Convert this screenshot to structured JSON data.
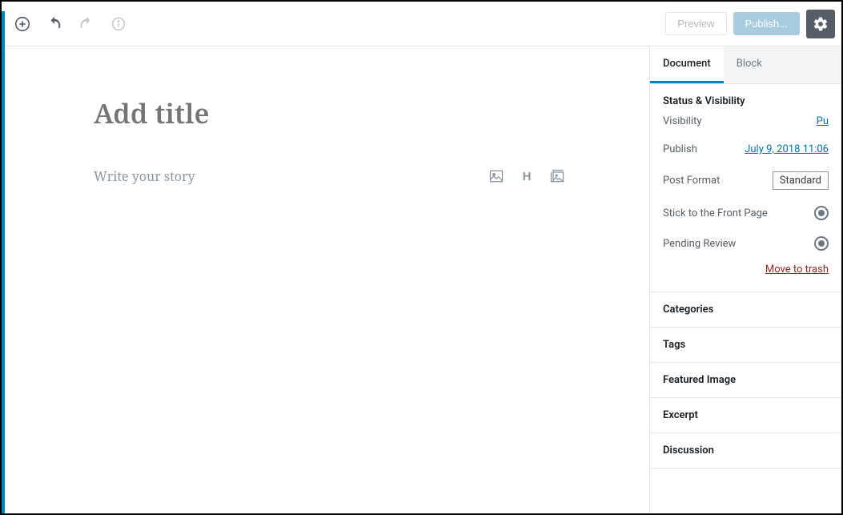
{
  "toolbar": {
    "preview_label": "Preview",
    "publish_label": "Publish..."
  },
  "editor": {
    "title_placeholder": "Add title",
    "content_placeholder": "Write your story"
  },
  "block_icons": {
    "image": "image-icon",
    "heading": "H",
    "gallery": "gallery-icon"
  },
  "sidebar": {
    "tabs": {
      "document": "Document",
      "block": "Block"
    },
    "status_panel": {
      "title": "Status & Visibility",
      "visibility_label": "Visibility",
      "visibility_value": "Pu",
      "publish_label": "Publish",
      "publish_value": "July 9, 2018 11:06",
      "post_format_label": "Post Format",
      "post_format_value": "Standard",
      "stick_label": "Stick to the Front Page",
      "pending_label": "Pending Review",
      "trash_label": "Move to trash"
    },
    "panels": {
      "categories": "Categories",
      "tags": "Tags",
      "featured_image": "Featured Image",
      "excerpt": "Excerpt",
      "discussion": "Discussion"
    }
  }
}
